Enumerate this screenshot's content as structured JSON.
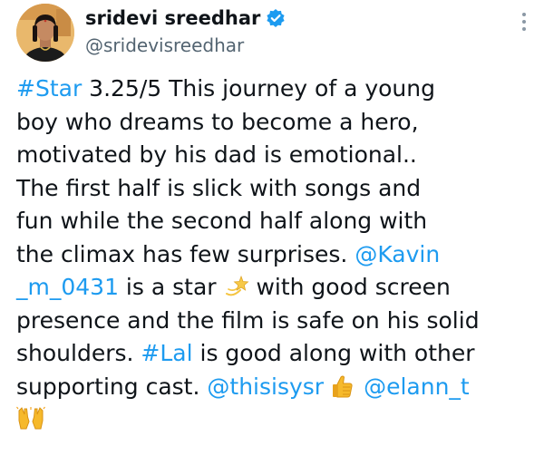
{
  "author": {
    "display_name": "sridevi sreedhar",
    "handle": "@sridevisreedhar"
  },
  "icons": {
    "avatar": "profile-photo",
    "verified": "verified-badge-icon",
    "more": "more-options-icon",
    "emoji_dizzy": "dizzy-star-emoji",
    "emoji_thumbs": "thumbs-up-emoji",
    "emoji_raised_hands": "raised-hands-emoji"
  },
  "colors": {
    "link": "#1d9bf0",
    "text": "#0f1419",
    "secondary": "#536471",
    "verified": "#1d9bf0"
  },
  "tweet": {
    "l1_tag": "#Star",
    "l1_text": " 3.25/5 This journey of a young",
    "l2": "boy who dreams to become a hero,",
    "l3": "motivated by his dad is emotional..",
    "l4": "The first half is slick with songs and",
    "l5": "fun while the second half along with",
    "l6_text": "the climax has few surprises. ",
    "l6_mention": "@Kavin",
    "l7_mention": "_m_0431",
    "l7_text_a": " is a star ",
    "l7_text_b": " with good screen",
    "l8": "presence and the film is safe on his solid",
    "l9_text_a": "shoulders. ",
    "l9_tag": "#Lal",
    "l9_text_b": " is good  along with other",
    "l10_text": "supporting cast. ",
    "l10_mention_a": "@thisisysr",
    "l10_mention_b": "@elann_t"
  }
}
